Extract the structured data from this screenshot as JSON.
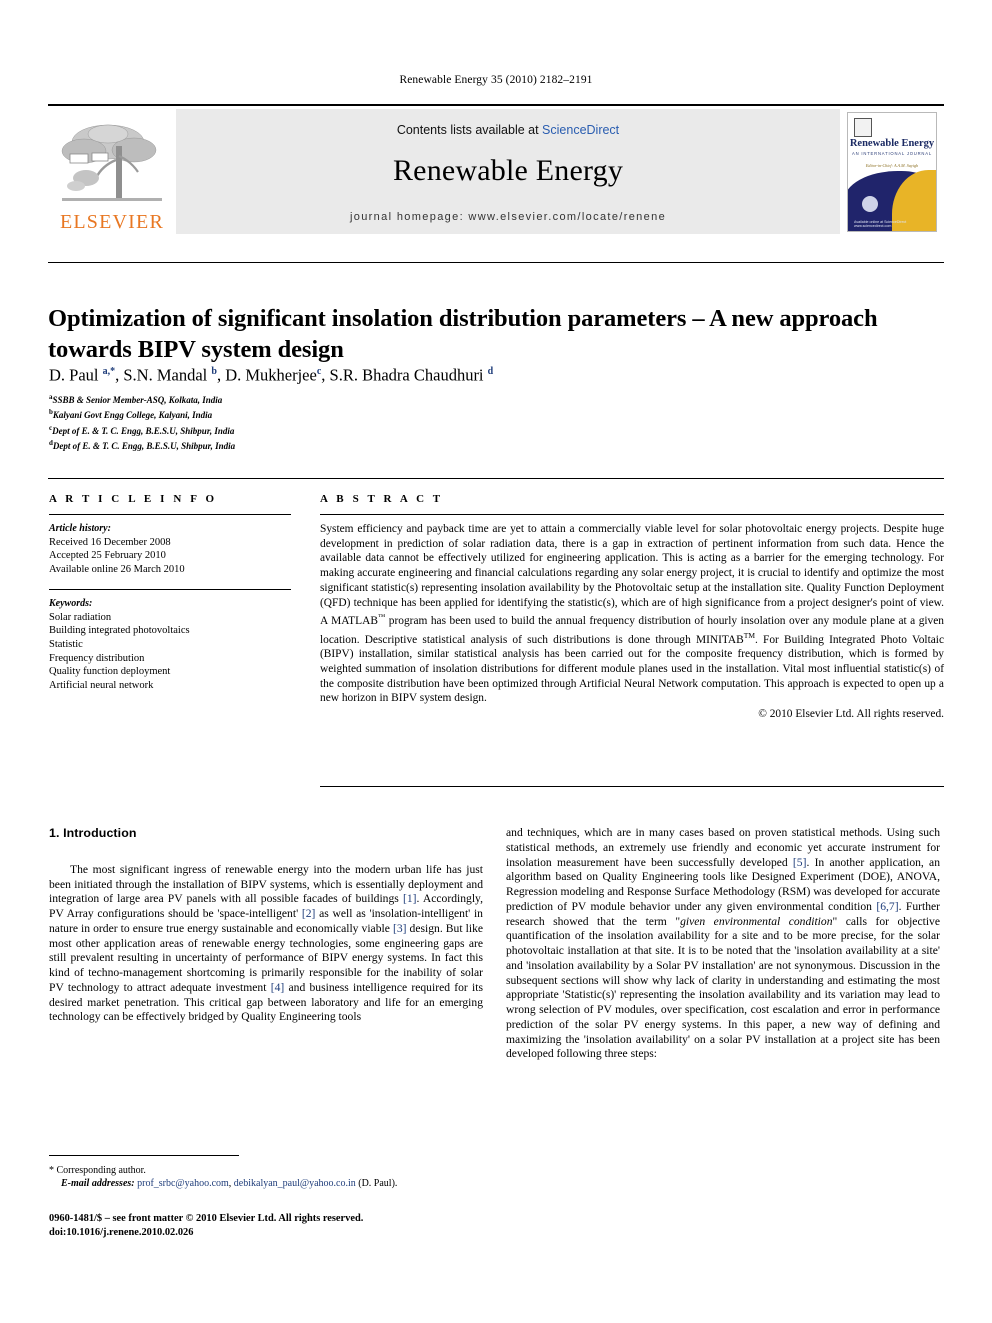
{
  "running_head": "Renewable Energy 35 (2010) 2182–2191",
  "masthead": {
    "publisher_name": "ELSEVIER",
    "contents_prefix": "Contents lists available at ",
    "contents_link": "ScienceDirect",
    "journal_title": "Renewable Energy",
    "journal_homepage": "journal homepage: www.elsevier.com/locate/renene",
    "cover": {
      "title": "Renewable Energy",
      "subtitle": "AN INTERNATIONAL JOURNAL",
      "tagline": "Editor-in-Chief: A.A.M. Sayigh",
      "footer": "Available online at ScienceDirect  www.sciencedirect.com"
    }
  },
  "article": {
    "title": "Optimization of significant insolation distribution parameters – A new approach towards BIPV system design",
    "authors_html": "D. Paul <sup>a,*</sup>, S.N. Mandal <sup>b</sup>, D. Mukherjee<sup>c</sup>, S.R. Bhadra Chaudhuri <sup>d</sup>",
    "affiliations": [
      {
        "marker": "a",
        "text": "SSBB & Senior Member-ASQ, Kolkata, India"
      },
      {
        "marker": "b",
        "text": "Kalyani Govt Engg College, Kalyani, India"
      },
      {
        "marker": "c",
        "text": "Dept of E. & T. C. Engg, B.E.S.U, Shibpur, India"
      },
      {
        "marker": "d",
        "text": "Dept of E. & T. C. Engg, B.E.S.U, Shibpur, India"
      }
    ]
  },
  "article_info": {
    "heading": "A R T I C L E    I N F O",
    "history_label": "Article history:",
    "history": [
      "Received 16 December 2008",
      "Accepted 25 February 2010",
      "Available online 26 March 2010"
    ],
    "keywords_label": "Keywords:",
    "keywords": [
      "Solar radiation",
      "Building integrated photovoltaics",
      "Statistic",
      "Frequency distribution",
      "Quality function deployment",
      "Artificial neural network"
    ]
  },
  "abstract": {
    "heading": "A B S T R A C T",
    "body_html": "System efficiency and payback time are yet to attain a commercially viable level for solar photovoltaic energy projects. Despite huge development in prediction of solar radiation data, there is a gap in extraction of pertinent information from such data. Hence the available data cannot be effectively utilized for engineering application. This is acting as a barrier for the emerging technology. For making accurate engineering and financial calculations regarding any solar energy project, it is crucial to identify and optimize the most significant statistic(s) representing insolation availability by the Photovoltaic setup at the installation site. Quality Function Deployment (QFD) technique has been applied for identifying the statistic(s), which are of high significance from a project designer's point of view. A MATLAB<sup>™</sup> program has been used to build the annual frequency distribution of hourly insolation over any module plane at a given location. Descriptive statistical analysis of such distributions is done through MINITAB<sup>TM</sup>. For Building Integrated Photo Voltaic (BIPV) installation, similar statistical analysis has been carried out for the composite frequency distribution, which is formed by weighted summation of insolation distributions for different module planes used in the installation. Vital most influential statistic(s) of the composite distribution have been optimized through Artificial Neural Network computation. This approach is expected to open up a new horizon in BIPV system design.",
    "copyright": "© 2010 Elsevier Ltd. All rights reserved."
  },
  "body": {
    "section_heading": "1. Introduction",
    "left_paragraph_html": "The most significant ingress of renewable energy into the modern urban life has just been initiated through the installation of BIPV systems, which is essentially deployment and integration of large area PV panels with all possible facades of buildings <span class=\"ref\">[1]</span>. Accordingly, PV Array configurations should be 'space-intelligent' <span class=\"ref\">[2]</span> as well as 'insolation-intelligent' in nature in order to ensure true energy sustainable and economically viable <span class=\"ref\">[3]</span> design. But like most other application areas of renewable energy technologies, some engineering gaps are still prevalent resulting in uncertainty of performance of BIPV energy systems. In fact this kind of techno-management shortcoming is primarily responsible for the inability of solar PV technology to attract adequate investment <span class=\"ref\">[4]</span> and business intelligence required for its desired market penetration. This critical gap between laboratory and life for an emerging technology can be effectively bridged by Quality Engineering tools",
    "right_paragraph_html": "and techniques, which are in many cases based on proven statistical methods. Using such statistical methods, an extremely use friendly and economic yet accurate instrument for insolation measurement have been successfully developed <span class=\"ref\">[5]</span>. In another application, an algorithm based on Quality Engineering tools like Designed Experiment (DOE), ANOVA, Regression modeling and Response Surface Methodology (RSM) was developed for accurate prediction of PV module behavior under any given environmental condition <span class=\"ref\">[6,7]</span>. Further research showed that the term \"<em class=\"it\">given environmental condition</em>\" calls for objective quantification of the insolation availability for a site and to be more precise, for the solar photovoltaic installation at that site. It is to be noted that the 'insolation availability at a site' and 'insolation availability by a Solar PV installation' are not synonymous. Discussion in the subsequent sections will show why lack of clarity in understanding and estimating the most appropriate 'Statistic(s)' representing the insolation availability and its variation may lead to wrong selection of PV modules, over specification, cost escalation and error in performance prediction of the solar PV energy systems. In this paper, a new way of defining and maximizing the 'insolation availability' on a solar PV installation at a project site has been developed following three steps:"
  },
  "footer": {
    "corresponding_label": "* Corresponding author.",
    "email_label": "E-mail addresses:",
    "email_1": "prof_srbc@yahoo.com",
    "email_2": "debikalyan_paul@yahoo.co.in",
    "email_suffix": "(D. Paul).",
    "issn_line": "0960-1481/$ – see front matter © 2010 Elsevier Ltd. All rights reserved.",
    "doi_line": "doi:10.1016/j.renene.2010.02.026"
  }
}
